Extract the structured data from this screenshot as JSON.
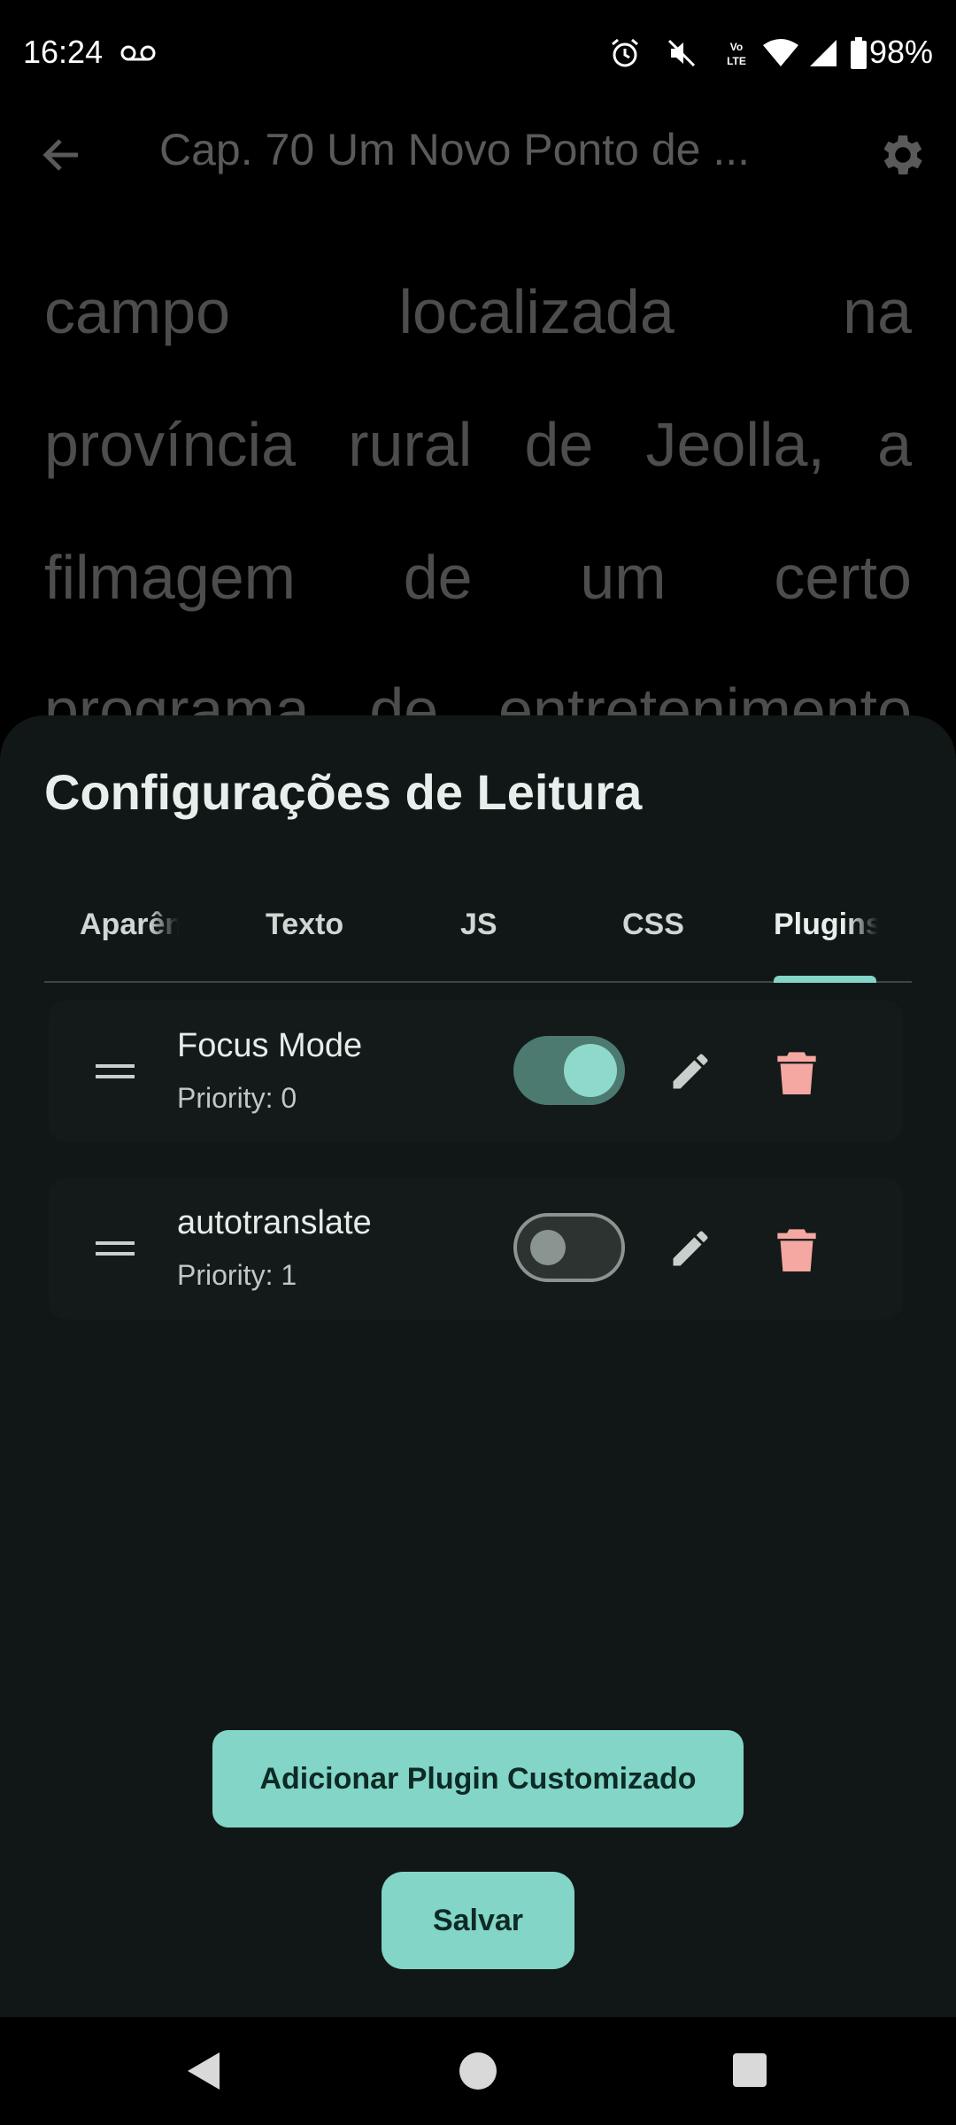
{
  "status_bar": {
    "time": "16:24",
    "battery": "98%",
    "icons": [
      "voicemail-icon",
      "alarm-icon",
      "mute-icon",
      "volte-icon",
      "wifi-icon",
      "signal-icon",
      "battery-icon"
    ]
  },
  "header": {
    "title": "Cap. 70 Um Novo Ponto de ...",
    "icons": [
      "back-arrow-icon",
      "gear-icon"
    ]
  },
  "reader": {
    "lines": [
      "campo localizada na",
      "província rural de Jeolla, a",
      "filmagem de um certo",
      "programa de entretenimento"
    ]
  },
  "sheet": {
    "title": "Configurações de Leitura",
    "tabs": [
      {
        "label": "Aparên"
      },
      {
        "label": "Texto"
      },
      {
        "label": "JS"
      },
      {
        "label": "CSS"
      },
      {
        "label": "Plugins",
        "selected": true
      }
    ],
    "plugins": [
      {
        "name": "Focus Mode",
        "priority": "Priority: 0",
        "enabled": true
      },
      {
        "name": "autotranslate",
        "priority": "Priority: 1",
        "enabled": false
      }
    ],
    "add_button_label": "Adicionar Plugin Customizado",
    "save_button_label": "Salvar"
  },
  "colors": {
    "accent": "#82d5c7",
    "sheet_background": "#111716",
    "delete": "#f4a8a1"
  },
  "nav_bar": {
    "icons": [
      "back-triangle-icon",
      "home-circle-icon",
      "recents-square-icon"
    ]
  }
}
